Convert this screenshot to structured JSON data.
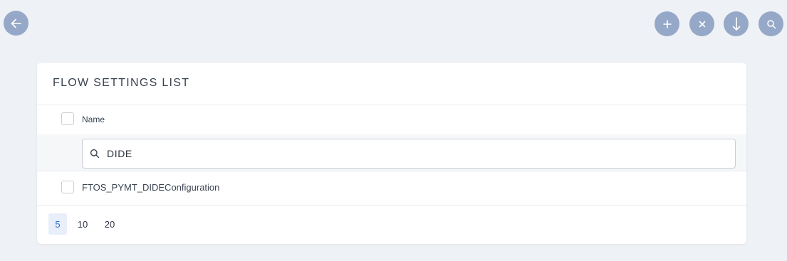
{
  "toolbar": {
    "back_icon": "arrow-left-icon",
    "add_icon": "plus-icon",
    "clear_icon": "close-icon",
    "download_icon": "arrow-down-icon",
    "search_icon": "search-icon",
    "button_color": "#96a8c8"
  },
  "card": {
    "title": "FLOW SETTINGS LIST",
    "column_header": "Name",
    "filter": {
      "value": "DIDE",
      "icon": "search-icon"
    },
    "rows": [
      {
        "name": "FTOS_PYMT_DIDEConfiguration"
      }
    ]
  },
  "pagination": {
    "options": [
      "5",
      "10",
      "20"
    ],
    "selected": "5",
    "accent": "#2f6fd1"
  }
}
